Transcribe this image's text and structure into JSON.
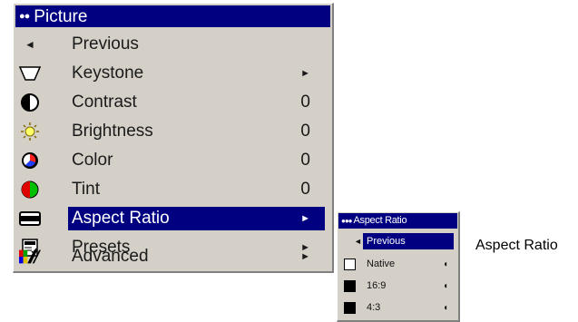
{
  "menu": {
    "title": "Picture",
    "items": [
      {
        "label": "Previous",
        "icon": "left-arrow-icon",
        "value": "",
        "arrow": ""
      },
      {
        "label": "Keystone",
        "icon": "keystone-icon",
        "value": "",
        "arrow": "►"
      },
      {
        "label": "Contrast",
        "icon": "contrast-icon",
        "value": "0",
        "arrow": ""
      },
      {
        "label": "Brightness",
        "icon": "sun-icon",
        "value": "0",
        "arrow": ""
      },
      {
        "label": "Color",
        "icon": "color-wheel-icon",
        "value": "0",
        "arrow": ""
      },
      {
        "label": "Tint",
        "icon": "tint-icon",
        "value": "0",
        "arrow": ""
      },
      {
        "label": "Aspect Ratio",
        "icon": "screen-icon",
        "value": "",
        "arrow": "►"
      },
      {
        "label": "Presets",
        "icon": "presets-icon",
        "value": "",
        "arrow": "►"
      },
      {
        "label": "Advanced",
        "icon": "advanced-icon",
        "value": "",
        "arrow": "►"
      }
    ]
  },
  "submenu": {
    "title": "Aspect Ratio",
    "items": [
      {
        "label": "Previous"
      },
      {
        "label": "Native"
      },
      {
        "label": "16:9"
      },
      {
        "label": "4:3"
      }
    ]
  },
  "caption": "Aspect Ratio",
  "colors": {
    "highlight": "#000080",
    "panel": "#d4d0c8"
  }
}
